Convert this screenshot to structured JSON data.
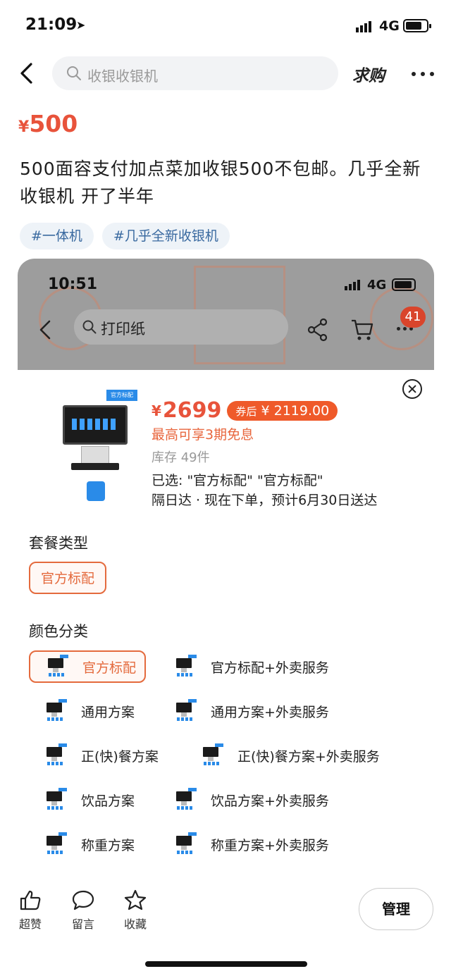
{
  "status": {
    "time": "21:09",
    "network": "4G"
  },
  "nav": {
    "search_placeholder": "收银收银机",
    "qiugou_label": "求购"
  },
  "listing": {
    "currency": "¥",
    "price": "500",
    "title": "500面容支付加点菜加收银500不包邮。几乎全新收银机 开了半年",
    "tags": [
      "#一体机",
      "#几乎全新收银机"
    ]
  },
  "embedded": {
    "status_time": "10:51",
    "network": "4G",
    "search_placeholder": "打印纸",
    "badge_count": "41",
    "sku": {
      "image_tag": "官方标配",
      "currency": "¥",
      "price": "2699",
      "coupon_label": "券后",
      "coupon_price": "¥ 2119.00",
      "installment": "最高可享3期免息",
      "stock": "库存 49件",
      "selected": "已选: \"官方标配\" \"官方标配\"",
      "delivery": "隔日达 · 现在下单，预计6月30日送达"
    },
    "package_section": {
      "title": "套餐类型",
      "options": [
        "官方标配"
      ]
    },
    "color_section": {
      "title": "颜色分类",
      "options": [
        "官方标配",
        "官方标配+外卖服务",
        "通用方案",
        "通用方案+外卖服务",
        "正(快)餐方案",
        "正(快)餐方案+外卖服务",
        "饮品方案",
        "饮品方案+外卖服务",
        "称重方案",
        "称重方案+外卖服务"
      ],
      "selected_index": 0
    }
  },
  "bottom_bar": {
    "like_label": "超赞",
    "comment_label": "留言",
    "favorite_label": "收藏",
    "manage_label": "管理"
  },
  "colors": {
    "accent": "#e8533b",
    "orange": "#e46a3d",
    "tag_blue": "#3a6aa0"
  }
}
